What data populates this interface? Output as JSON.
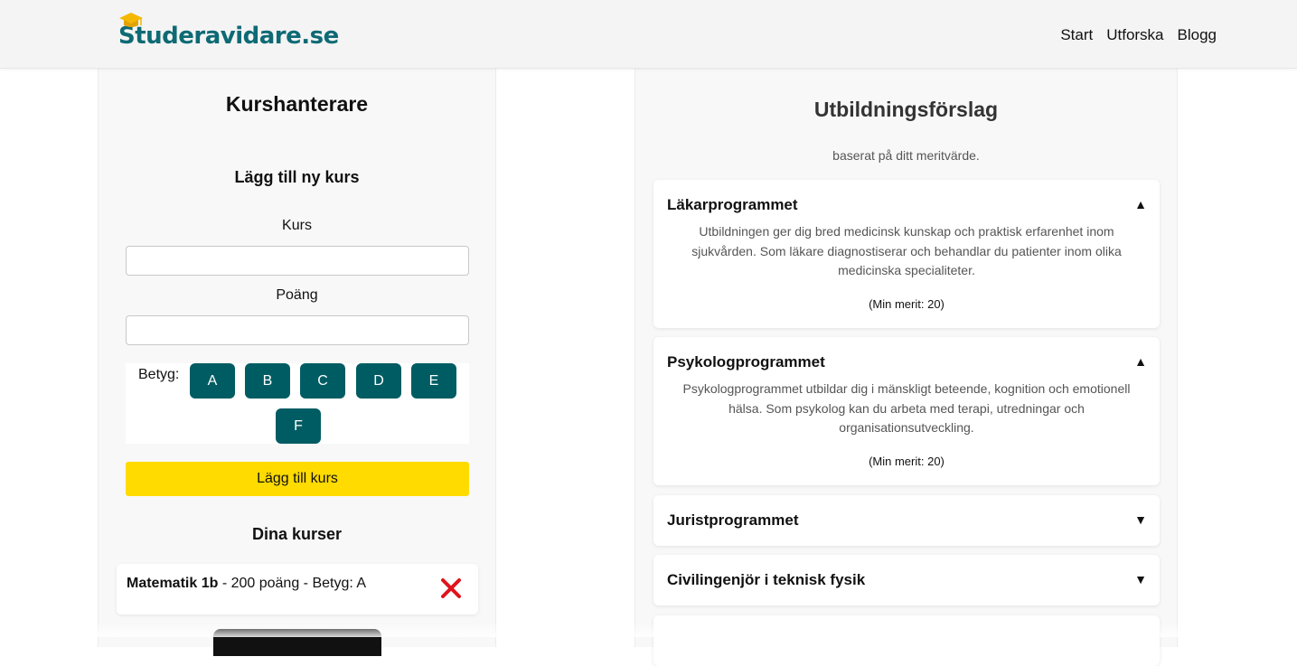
{
  "header": {
    "logo_text": "Studeravidare.se",
    "logo_icon": "graduation-cap-icon",
    "brand_color": "#0e6a74",
    "nav": [
      "Start",
      "Utforska",
      "Blogg"
    ]
  },
  "left": {
    "title": "Kurshanterare",
    "subtitle": "Lägg till ny kurs",
    "course_label": "Kurs",
    "course_value": "",
    "points_label": "Poäng",
    "points_value": "",
    "grade_label": "Betyg:",
    "grades": [
      "A",
      "B",
      "C",
      "D",
      "E",
      "F"
    ],
    "grade_color": "#005c63",
    "add_button": "Lägg till kurs",
    "add_button_color": "#ffdb00",
    "your_courses_title": "Dina kurser",
    "courses": [
      {
        "name": "Matematik 1b",
        "detail": " - 200 poäng - Betyg: A",
        "delete_icon": "close-icon"
      }
    ]
  },
  "right": {
    "title": "Utbildningsförslag",
    "subtitle": "baserat på ditt meritvärde.",
    "programs": [
      {
        "name": "Läkarprogrammet",
        "arrow": "▲",
        "expanded": true,
        "description": "Utbildningen ger dig bred medicinsk kunskap och praktisk erfarenhet inom sjukvården. Som läkare diagnostiserar och behandlar du patienter inom olika medicinska specialiteter.",
        "merit": "(Min merit: 20)"
      },
      {
        "name": "Psykologprogrammet",
        "arrow": "▲",
        "expanded": true,
        "description": "Psykologprogrammet utbildar dig i mänskligt beteende, kognition och emotionell hälsa. Som psykolog kan du arbeta med terapi, utredningar och organisationsutveckling.",
        "merit": "(Min merit: 20)"
      },
      {
        "name": "Juristprogrammet",
        "arrow": "▼",
        "expanded": false
      },
      {
        "name": "Civilingenjör i teknisk fysik",
        "arrow": "▼",
        "expanded": false
      }
    ]
  }
}
